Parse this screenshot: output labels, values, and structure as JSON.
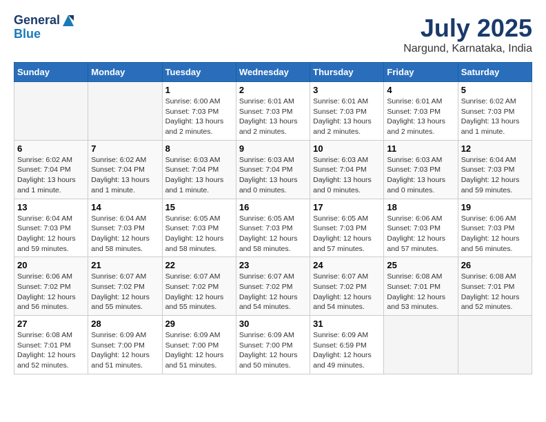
{
  "logo": {
    "line1": "General",
    "line2": "Blue"
  },
  "title": "July 2025",
  "subtitle": "Nargund, Karnataka, India",
  "days_header": [
    "Sunday",
    "Monday",
    "Tuesday",
    "Wednesday",
    "Thursday",
    "Friday",
    "Saturday"
  ],
  "weeks": [
    [
      {
        "day": "",
        "detail": ""
      },
      {
        "day": "",
        "detail": ""
      },
      {
        "day": "1",
        "detail": "Sunrise: 6:00 AM\nSunset: 7:03 PM\nDaylight: 13 hours and 2 minutes."
      },
      {
        "day": "2",
        "detail": "Sunrise: 6:01 AM\nSunset: 7:03 PM\nDaylight: 13 hours and 2 minutes."
      },
      {
        "day": "3",
        "detail": "Sunrise: 6:01 AM\nSunset: 7:03 PM\nDaylight: 13 hours and 2 minutes."
      },
      {
        "day": "4",
        "detail": "Sunrise: 6:01 AM\nSunset: 7:03 PM\nDaylight: 13 hours and 2 minutes."
      },
      {
        "day": "5",
        "detail": "Sunrise: 6:02 AM\nSunset: 7:03 PM\nDaylight: 13 hours and 1 minute."
      }
    ],
    [
      {
        "day": "6",
        "detail": "Sunrise: 6:02 AM\nSunset: 7:04 PM\nDaylight: 13 hours and 1 minute."
      },
      {
        "day": "7",
        "detail": "Sunrise: 6:02 AM\nSunset: 7:04 PM\nDaylight: 13 hours and 1 minute."
      },
      {
        "day": "8",
        "detail": "Sunrise: 6:03 AM\nSunset: 7:04 PM\nDaylight: 13 hours and 1 minute."
      },
      {
        "day": "9",
        "detail": "Sunrise: 6:03 AM\nSunset: 7:04 PM\nDaylight: 13 hours and 0 minutes."
      },
      {
        "day": "10",
        "detail": "Sunrise: 6:03 AM\nSunset: 7:04 PM\nDaylight: 13 hours and 0 minutes."
      },
      {
        "day": "11",
        "detail": "Sunrise: 6:03 AM\nSunset: 7:03 PM\nDaylight: 13 hours and 0 minutes."
      },
      {
        "day": "12",
        "detail": "Sunrise: 6:04 AM\nSunset: 7:03 PM\nDaylight: 12 hours and 59 minutes."
      }
    ],
    [
      {
        "day": "13",
        "detail": "Sunrise: 6:04 AM\nSunset: 7:03 PM\nDaylight: 12 hours and 59 minutes."
      },
      {
        "day": "14",
        "detail": "Sunrise: 6:04 AM\nSunset: 7:03 PM\nDaylight: 12 hours and 58 minutes."
      },
      {
        "day": "15",
        "detail": "Sunrise: 6:05 AM\nSunset: 7:03 PM\nDaylight: 12 hours and 58 minutes."
      },
      {
        "day": "16",
        "detail": "Sunrise: 6:05 AM\nSunset: 7:03 PM\nDaylight: 12 hours and 58 minutes."
      },
      {
        "day": "17",
        "detail": "Sunrise: 6:05 AM\nSunset: 7:03 PM\nDaylight: 12 hours and 57 minutes."
      },
      {
        "day": "18",
        "detail": "Sunrise: 6:06 AM\nSunset: 7:03 PM\nDaylight: 12 hours and 57 minutes."
      },
      {
        "day": "19",
        "detail": "Sunrise: 6:06 AM\nSunset: 7:03 PM\nDaylight: 12 hours and 56 minutes."
      }
    ],
    [
      {
        "day": "20",
        "detail": "Sunrise: 6:06 AM\nSunset: 7:02 PM\nDaylight: 12 hours and 56 minutes."
      },
      {
        "day": "21",
        "detail": "Sunrise: 6:07 AM\nSunset: 7:02 PM\nDaylight: 12 hours and 55 minutes."
      },
      {
        "day": "22",
        "detail": "Sunrise: 6:07 AM\nSunset: 7:02 PM\nDaylight: 12 hours and 55 minutes."
      },
      {
        "day": "23",
        "detail": "Sunrise: 6:07 AM\nSunset: 7:02 PM\nDaylight: 12 hours and 54 minutes."
      },
      {
        "day": "24",
        "detail": "Sunrise: 6:07 AM\nSunset: 7:02 PM\nDaylight: 12 hours and 54 minutes."
      },
      {
        "day": "25",
        "detail": "Sunrise: 6:08 AM\nSunset: 7:01 PM\nDaylight: 12 hours and 53 minutes."
      },
      {
        "day": "26",
        "detail": "Sunrise: 6:08 AM\nSunset: 7:01 PM\nDaylight: 12 hours and 52 minutes."
      }
    ],
    [
      {
        "day": "27",
        "detail": "Sunrise: 6:08 AM\nSunset: 7:01 PM\nDaylight: 12 hours and 52 minutes."
      },
      {
        "day": "28",
        "detail": "Sunrise: 6:09 AM\nSunset: 7:00 PM\nDaylight: 12 hours and 51 minutes."
      },
      {
        "day": "29",
        "detail": "Sunrise: 6:09 AM\nSunset: 7:00 PM\nDaylight: 12 hours and 51 minutes."
      },
      {
        "day": "30",
        "detail": "Sunrise: 6:09 AM\nSunset: 7:00 PM\nDaylight: 12 hours and 50 minutes."
      },
      {
        "day": "31",
        "detail": "Sunrise: 6:09 AM\nSunset: 6:59 PM\nDaylight: 12 hours and 49 minutes."
      },
      {
        "day": "",
        "detail": ""
      },
      {
        "day": "",
        "detail": ""
      }
    ]
  ]
}
